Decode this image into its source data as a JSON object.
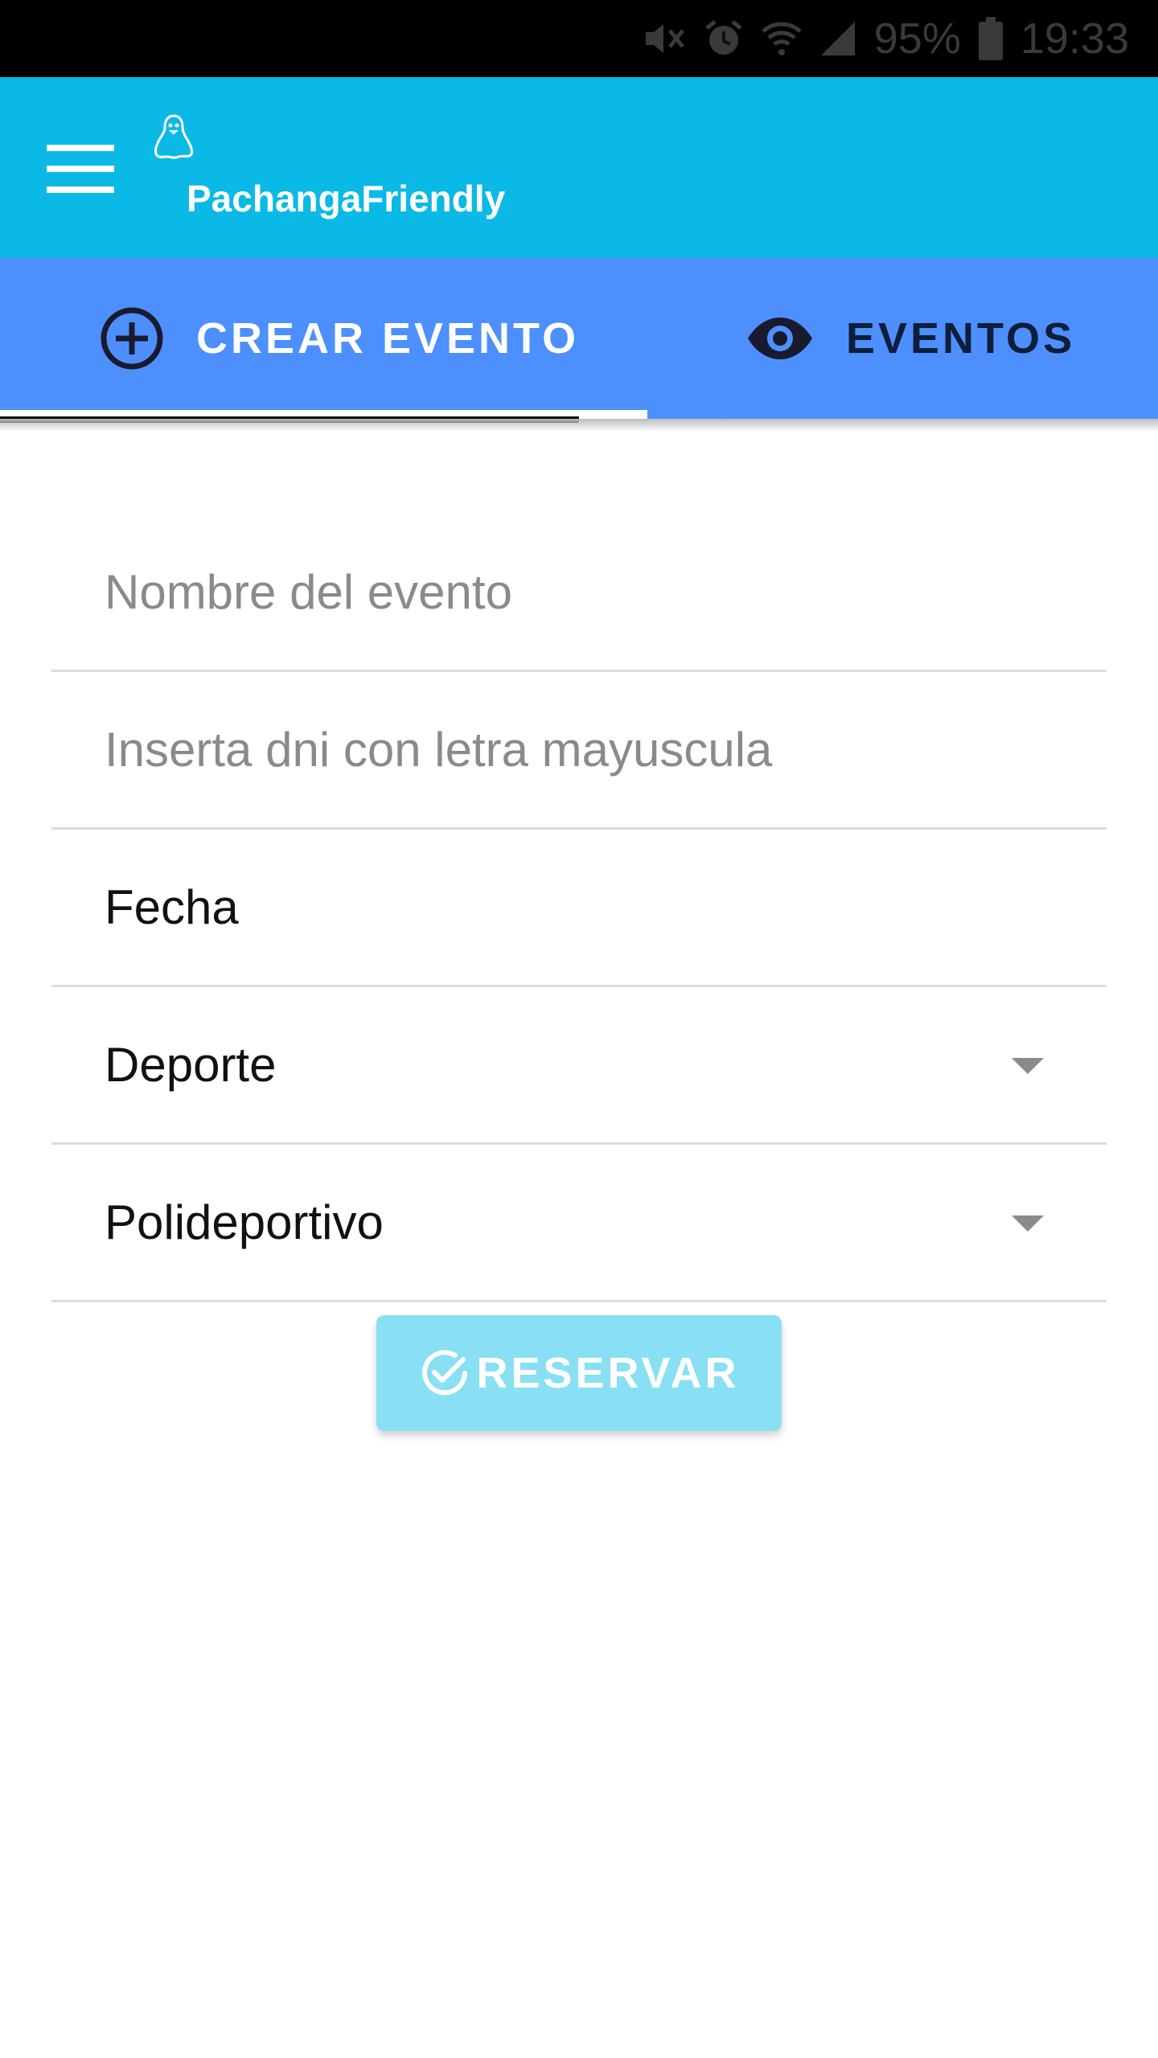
{
  "status_bar": {
    "battery": "95%",
    "time": "19:33",
    "icons": [
      "mute-icon",
      "alarm-icon",
      "wifi-icon",
      "signal-icon",
      "battery-icon"
    ]
  },
  "app_bar": {
    "title": "PachangaFriendly",
    "color": "#0bb9e6",
    "icons": [
      "menu-icon",
      "penguin-logo-icon"
    ]
  },
  "tabs": [
    {
      "label": "CREAR EVENTO",
      "icon": "add-circle-icon",
      "selected": true
    },
    {
      "label": "EVENTOS",
      "icon": "eye-icon",
      "selected": false
    }
  ],
  "tabs_color": "#4d8ffd",
  "form": {
    "event_name": {
      "placeholder": "Nombre del evento",
      "value": ""
    },
    "dni": {
      "placeholder": "Inserta dni con letra mayuscula",
      "value": ""
    },
    "date_label": "Fecha",
    "sport_select": {
      "selected": "Deporte"
    },
    "venue_select": {
      "selected": "Polideportivo"
    }
  },
  "reserve_button": {
    "label": "RESERVAR",
    "icon": "check-circle-icon",
    "color": "#89dff3"
  }
}
